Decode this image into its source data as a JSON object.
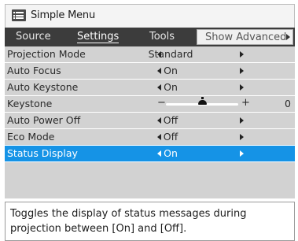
{
  "window": {
    "title": "Simple Menu"
  },
  "tabs": {
    "source": "Source",
    "settings": "Settings",
    "tools": "Tools",
    "advanced": "Show Advanced"
  },
  "rows": [
    {
      "label": "Projection Mode",
      "value": "Standard"
    },
    {
      "label": "Auto Focus",
      "value": "On"
    },
    {
      "label": "Auto Keystone",
      "value": "On"
    },
    {
      "label": "Keystone",
      "value": "0",
      "slider_level": 0.5
    },
    {
      "label": "Auto Power Off",
      "value": "Off"
    },
    {
      "label": "Eco Mode",
      "value": "Off"
    },
    {
      "label": "Status Display",
      "value": "On",
      "selected": true
    }
  ],
  "description": "Toggles the display of status messages during projection between [On] and [Off].",
  "colors": {
    "selection": "#1593e6",
    "tab_bar": "#3c3c3c",
    "list_bg": "#d2d2d2"
  },
  "icons": {
    "title": "menu-list-icon"
  }
}
